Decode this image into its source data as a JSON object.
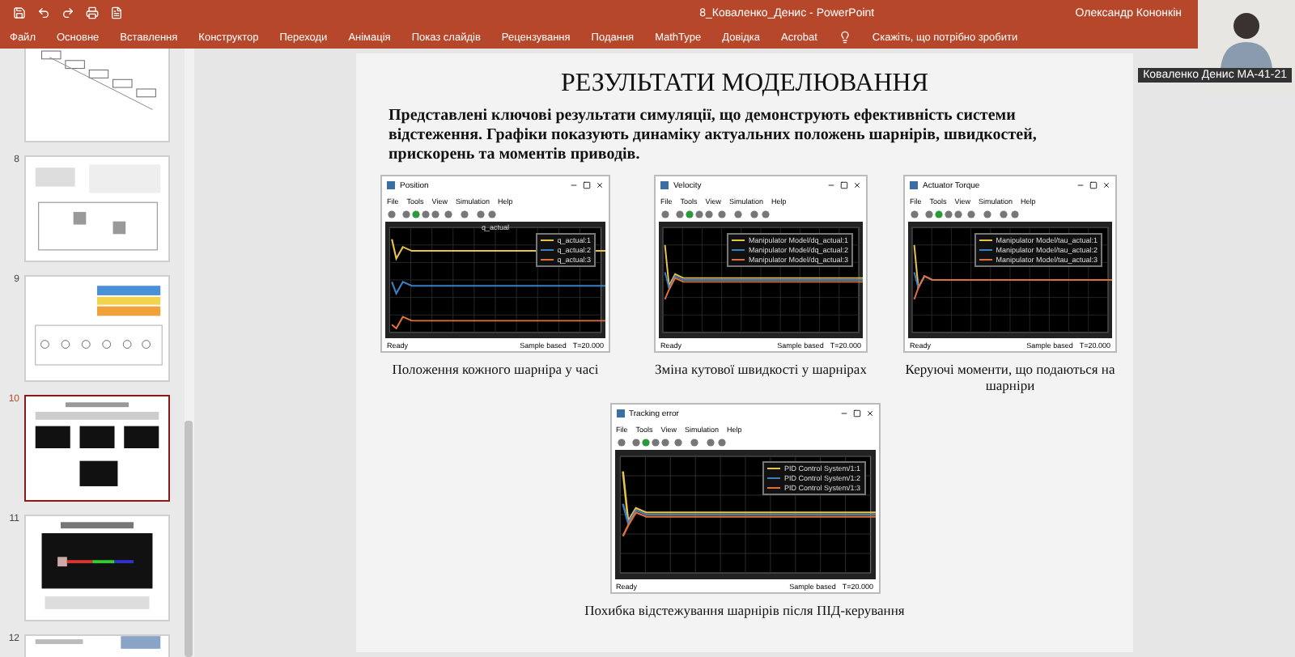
{
  "app": {
    "title": "8_Коваленко_Денис  -  PowerPoint",
    "user": "Олександр Кононкін"
  },
  "ribbon_tabs": [
    "Файл",
    "Основне",
    "Вставлення",
    "Конструктор",
    "Переходи",
    "Анімація",
    "Показ слайдів",
    "Рецензування",
    "Подання",
    "MathType",
    "Довідка",
    "Acrobat"
  ],
  "tell_me": {
    "placeholder": "Скажіть, що потрібно зробити"
  },
  "thumbnails": [
    {
      "kind": "diagram",
      "selected": false
    },
    {
      "number": "8",
      "kind": "schematic",
      "selected": false
    },
    {
      "number": "9",
      "kind": "blocks",
      "selected": false
    },
    {
      "number": "10",
      "kind": "charts",
      "selected": true
    },
    {
      "number": "11",
      "kind": "render",
      "selected": false
    },
    {
      "number": "12",
      "kind": "partial",
      "selected": false
    }
  ],
  "slide": {
    "title": "РЕЗУЛЬТАТИ МОДЕЛЮВАННЯ",
    "body": "Представлені ключові результати симуляції, що демонструють ефективність системи відстеження. Графіки показують динаміку актуальних положень шарнірів, швидкостей, прискорень та моментів приводів.",
    "figures": [
      {
        "window_title": "Position",
        "menu": [
          "File",
          "Tools",
          "View",
          "Simulation",
          "Help"
        ],
        "plot_title": "q_actual",
        "legend": [
          {
            "label": "q_actual:1",
            "color": "#e8c34a"
          },
          {
            "label": "q_actual:2",
            "color": "#3d7fc1"
          },
          {
            "label": "q_actual:3",
            "color": "#e0703a"
          }
        ],
        "status": "Ready",
        "sample": "Sample based",
        "time": "T=20.000",
        "caption": "Положення кожного шарніра у часі"
      },
      {
        "window_title": "Velocity",
        "menu": [
          "File",
          "Tools",
          "View",
          "Simulation",
          "Help"
        ],
        "legend": [
          {
            "label": "Manipulator Model/dq_actual:1",
            "color": "#e8c34a"
          },
          {
            "label": "Manipulator Model/dq_actual:2",
            "color": "#3d7fc1"
          },
          {
            "label": "Manipulator Model/dq_actual:3",
            "color": "#e0703a"
          }
        ],
        "status": "Ready",
        "sample": "Sample based",
        "time": "T=20.000",
        "caption": "Зміна кутової швидкості у шарнірах"
      },
      {
        "window_title": "Actuator Torque",
        "menu": [
          "File",
          "Tools",
          "View",
          "Simulation",
          "Help"
        ],
        "legend": [
          {
            "label": "Manipulator Model/tau_actual:1",
            "color": "#e8c34a"
          },
          {
            "label": "Manipulator Model/tau_actual:2",
            "color": "#3d7fc1"
          },
          {
            "label": "Manipulator Model/tau_actual:3",
            "color": "#e0703a"
          }
        ],
        "status": "Ready",
        "sample": "Sample based",
        "time": "T=20.000",
        "caption": "Керуючі моменти, що подаються на шарніри"
      },
      {
        "window_title": "Tracking error",
        "menu": [
          "File",
          "Tools",
          "View",
          "Simulation",
          "Help"
        ],
        "legend": [
          {
            "label": "PID Control System/1:1",
            "color": "#e8c34a"
          },
          {
            "label": "PID Control System/1:2",
            "color": "#3d7fc1"
          },
          {
            "label": "PID Control System/1:3",
            "color": "#e0703a"
          }
        ],
        "status": "Ready",
        "sample": "Sample based",
        "time": "T=20.000",
        "caption": "Похибка відстежування шарнірів після ПІД-керування"
      }
    ]
  },
  "video": {
    "name": "Коваленко Денис МА-41-21"
  }
}
